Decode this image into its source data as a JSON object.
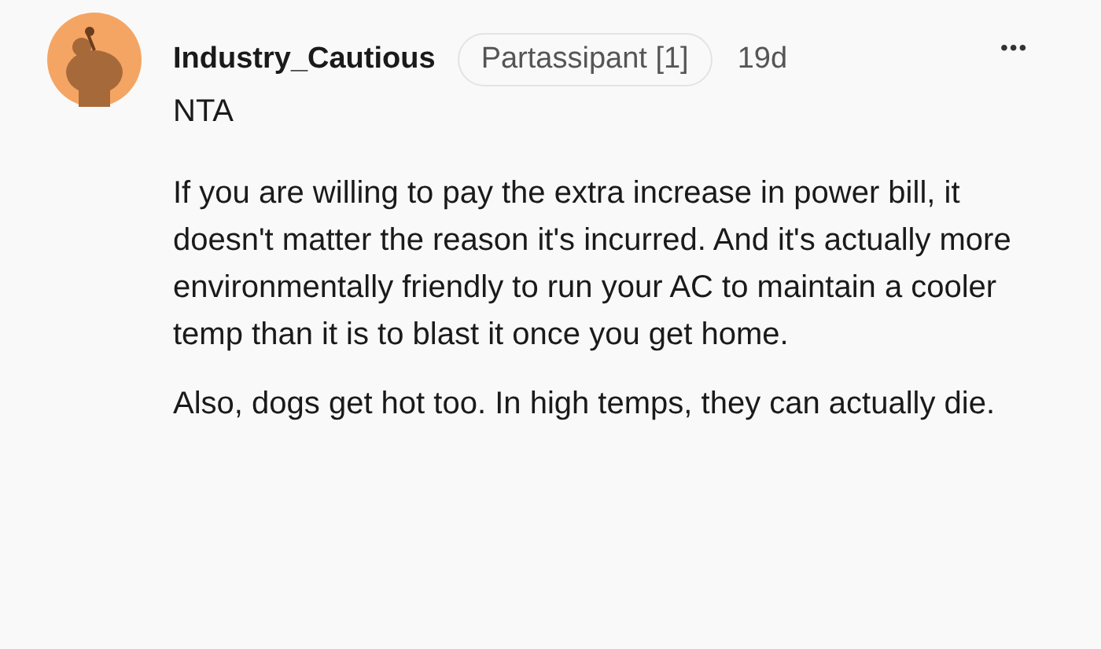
{
  "comment": {
    "author": "Industry_Cautious",
    "flair": "Partassipant [1]",
    "age": "19d",
    "more": "•••",
    "paragraphs": [
      "NTA",
      "If you are willing to pay the extra increase in power bill, it doesn't matter the reason it's incurred. And it's actually more environmentally friendly to run your AC to maintain a cooler temp than it is to blast it once you get home.",
      "Also, dogs get hot too. In high temps, they can actually die."
    ]
  }
}
